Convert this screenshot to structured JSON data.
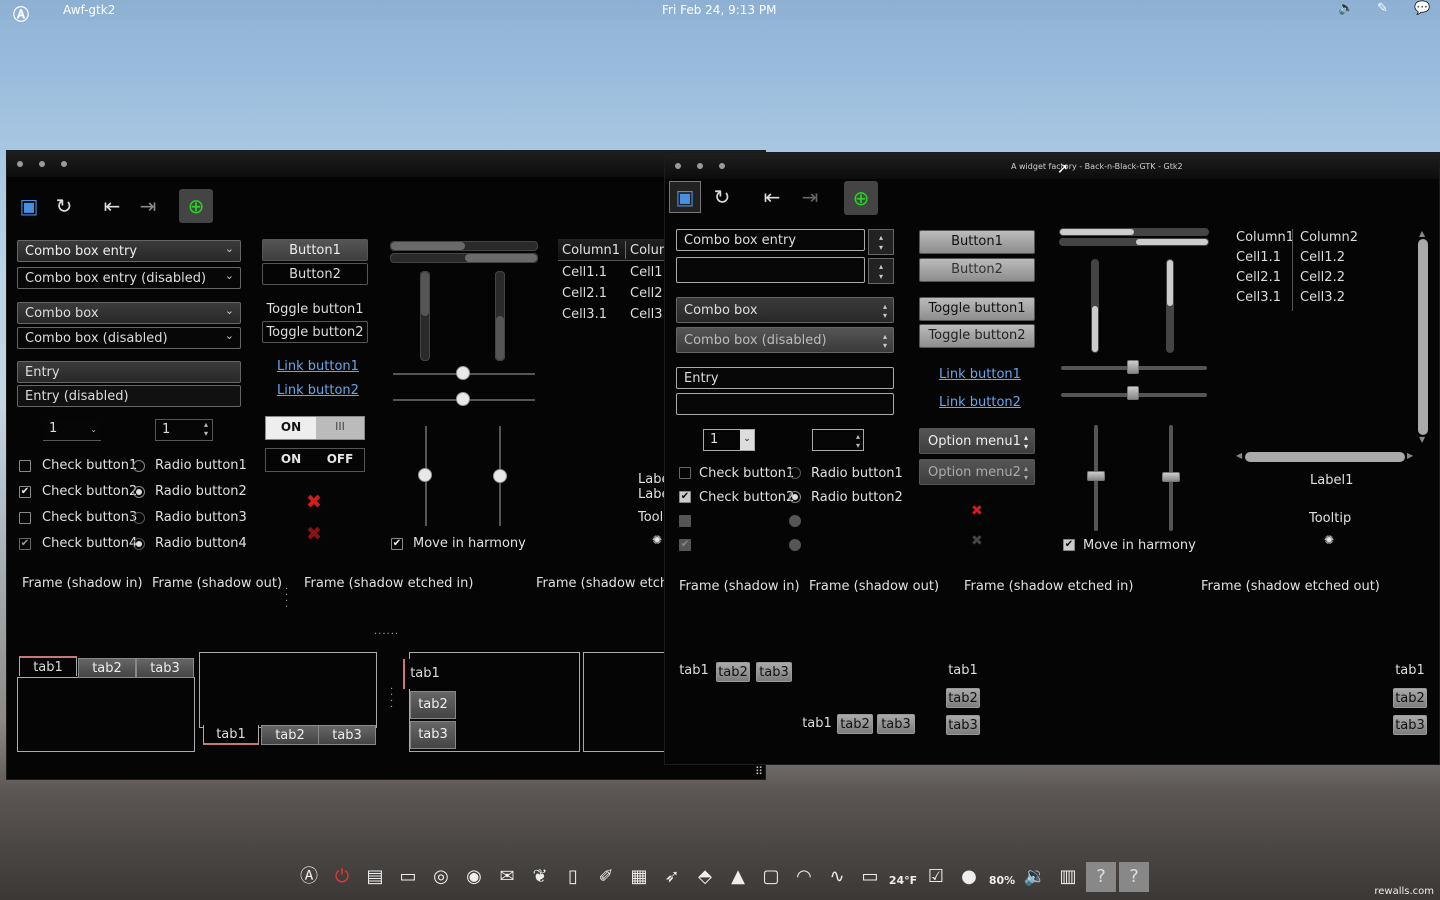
{
  "topbar": {
    "logo": "Ⓐ",
    "app_name": "Awf-gtk2",
    "clock": "Fri Feb 24,  9:13 PM",
    "icons": [
      "volume-icon",
      "pen-icon",
      "chat-icon"
    ]
  },
  "left_window": {
    "combo_entry": "Combo box entry",
    "combo_entry_disabled": "Combo box entry (disabled)",
    "combo": "Combo box",
    "combo_disabled": "Combo box (disabled)",
    "entry": "Entry",
    "entry_disabled": "Entry (disabled)",
    "spin1": "1",
    "spin2": "1",
    "checks": [
      "Check button1",
      "Check button2",
      "Check button3",
      "Check button4"
    ],
    "radios": [
      "Radio button1",
      "Radio button2",
      "Radio button3",
      "Radio button4"
    ],
    "button1": "Button1",
    "button2": "Button2",
    "toggle1": "Toggle button1",
    "toggle2": "Toggle button2",
    "link1": "Link button1",
    "link2": "Link button2",
    "switch_on": "ON",
    "switch_on2": "ON",
    "switch_off": "OFF",
    "switch_bars": "III",
    "harmony": "Move in harmony",
    "tree_headers": [
      "Column1",
      "Colum"
    ],
    "tree_rows": [
      [
        "Cell1.1",
        "Cell1."
      ],
      [
        "Cell2.1",
        "Cell2."
      ],
      [
        "Cell3.1",
        "Cell3."
      ]
    ],
    "label_partial": "Labe",
    "label_partial2": "Labe",
    "tooltip_partial": "Tool",
    "frames": [
      "Frame (shadow in)",
      "Frame (shadow out)",
      "Frame (shadow etched in)",
      "Frame (shadow etche"
    ],
    "tabs": [
      "tab1",
      "tab2",
      "tab3"
    ]
  },
  "right_window": {
    "title": "A widget factory - Back-n-Black-GTK - Gtk2",
    "combo_entry": "Combo box entry",
    "combo": "Combo box",
    "combo_disabled": "Combo box (disabled)",
    "entry": "Entry",
    "spin1": "1",
    "checks": [
      "Check button1",
      "Check button2"
    ],
    "radios": [
      "Radio button1",
      "Radio button2"
    ],
    "button1": "Button1",
    "button2": "Button2",
    "toggle1": "Toggle button1",
    "toggle2": "Toggle button2",
    "link1": "Link button1",
    "link2": "Link button2",
    "option1": "Option menu1",
    "option2": "Option menu2",
    "harmony": "Move in harmony",
    "tree_headers": [
      "Column1",
      "Column2"
    ],
    "tree_rows": [
      [
        "Cell1.1",
        "Cell1.2"
      ],
      [
        "Cell2.1",
        "Cell2.2"
      ],
      [
        "Cell3.1",
        "Cell3.2"
      ]
    ],
    "label1": "Label1",
    "tooltip": "Tooltip",
    "frames": [
      "Frame (shadow in)",
      "Frame (shadow out)",
      "Frame (shadow etched in)",
      "Frame (shadow etched out)"
    ],
    "tabs": [
      "tab1",
      "tab2",
      "tab3"
    ]
  },
  "dock": {
    "temp": "24°F",
    "percent": "80%",
    "icons": [
      "arch-icon",
      "power-icon",
      "files-icon",
      "terminal-icon",
      "chrome-icon",
      "firefox-icon",
      "mail-icon",
      "butterfly-icon",
      "document-icon",
      "brush-icon",
      "calculator-icon",
      "bird-icon",
      "network-icon",
      "arch-logo-icon",
      "book-icon",
      "headphones-icon",
      "monitor-wave-icon",
      "display-icon",
      "weather-icon",
      "tasks-icon",
      "ball-icon",
      "gauge-icon",
      "volume-icon",
      "tray-icon",
      "help-icon",
      "help2-icon"
    ]
  },
  "watermark": "rewalls.com"
}
